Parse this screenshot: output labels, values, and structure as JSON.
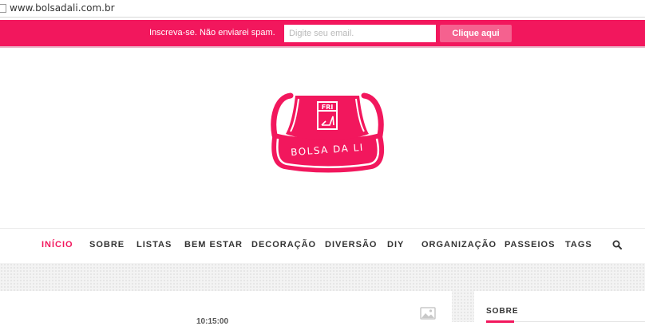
{
  "browser": {
    "url": "www.bolsadali.com.br"
  },
  "subscribe_bar": {
    "message": "Inscreva-se. Não enviarei spam.",
    "email_placeholder": "Digite seu email.",
    "button_label": "Clique aqui"
  },
  "logo": {
    "badge_text": "FRI",
    "brand_text": "BOLSA DA LI",
    "color": "#f2175d"
  },
  "nav": {
    "items": [
      {
        "label": "INÍCIO",
        "active": true
      },
      {
        "label": "SOBRE"
      },
      {
        "label": "LISTAS"
      },
      {
        "label": "BEM ESTAR"
      },
      {
        "label": "DECORAÇÃO"
      },
      {
        "label": "DIVERSÃO"
      },
      {
        "label": "DIY"
      },
      {
        "label": "ORGANIZAÇÃO"
      },
      {
        "label": "PASSEIOS"
      },
      {
        "label": "TAGS"
      }
    ],
    "search_icon": "search-icon"
  },
  "post": {
    "time": "10:15:00",
    "image_icon": "image-placeholder-icon"
  },
  "sidebar": {
    "title": "SOBRE"
  },
  "colors": {
    "accent": "#f2175d",
    "accent_light": "#f5618f"
  }
}
